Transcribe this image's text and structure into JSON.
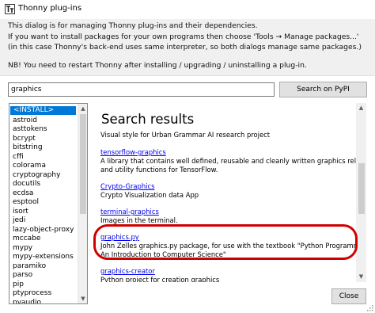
{
  "window": {
    "title": "Thonny plug-ins",
    "title_icon": "thonny-icon"
  },
  "info": {
    "lines": [
      "This dialog is for managing Thonny plug-ins and their dependencies.",
      "If you want to install packages for your own programs then choose 'Tools → Manage packages...'",
      "(in this case Thonny's back-end uses same interpreter, so both dialogs manage same packages.)",
      "NB! You need to restart Thonny after installing / upgrading / uninstalling a plug-in."
    ]
  },
  "search": {
    "value": "graphics",
    "button_label": "Search on PyPI"
  },
  "packages": [
    "<INSTALL>",
    "astroid",
    "asttokens",
    "bcrypt",
    "bitstring",
    "cffi",
    "colorama",
    "cryptography",
    "docutils",
    "ecdsa",
    "esptool",
    "isort",
    "jedi",
    "lazy-object-proxy",
    "mccabe",
    "mypy",
    "mypy-extensions",
    "paramiko",
    "parso",
    "pip",
    "ptyprocess",
    "pyaudio"
  ],
  "selected_package": "<INSTALL>",
  "results": {
    "heading": "Search results",
    "items": [
      {
        "name": "",
        "description": [
          "Visual style for Urban Grammar AI research project"
        ]
      },
      {
        "name": "tensorflow-graphics",
        "description": [
          "A library that contains well defined, reusable and cleanly written graphics related ops",
          "and utility functions for TensorFlow."
        ]
      },
      {
        "name": "Crypto-Graphics",
        "description": [
          "Crypto Visualization data App"
        ]
      },
      {
        "name": "terminal-graphics",
        "description": [
          "Images in the terminal."
        ]
      },
      {
        "name": "graphics.py",
        "description": [
          "John Zelles graphics.py package, for use with the textbook \"Python Programming:",
          "An Introduction to Computer Science\""
        ]
      },
      {
        "name": "graphics-creator",
        "description": [
          "Python project for creation qraphics"
        ]
      }
    ],
    "highlighted_item": "graphics.py",
    "highlight_color": "#d10000",
    "link_color": "#0000ee"
  },
  "footer": {
    "close_label": "Close"
  },
  "colors": {
    "selection": "#0078d7",
    "info_background": "#f0f0f0"
  }
}
